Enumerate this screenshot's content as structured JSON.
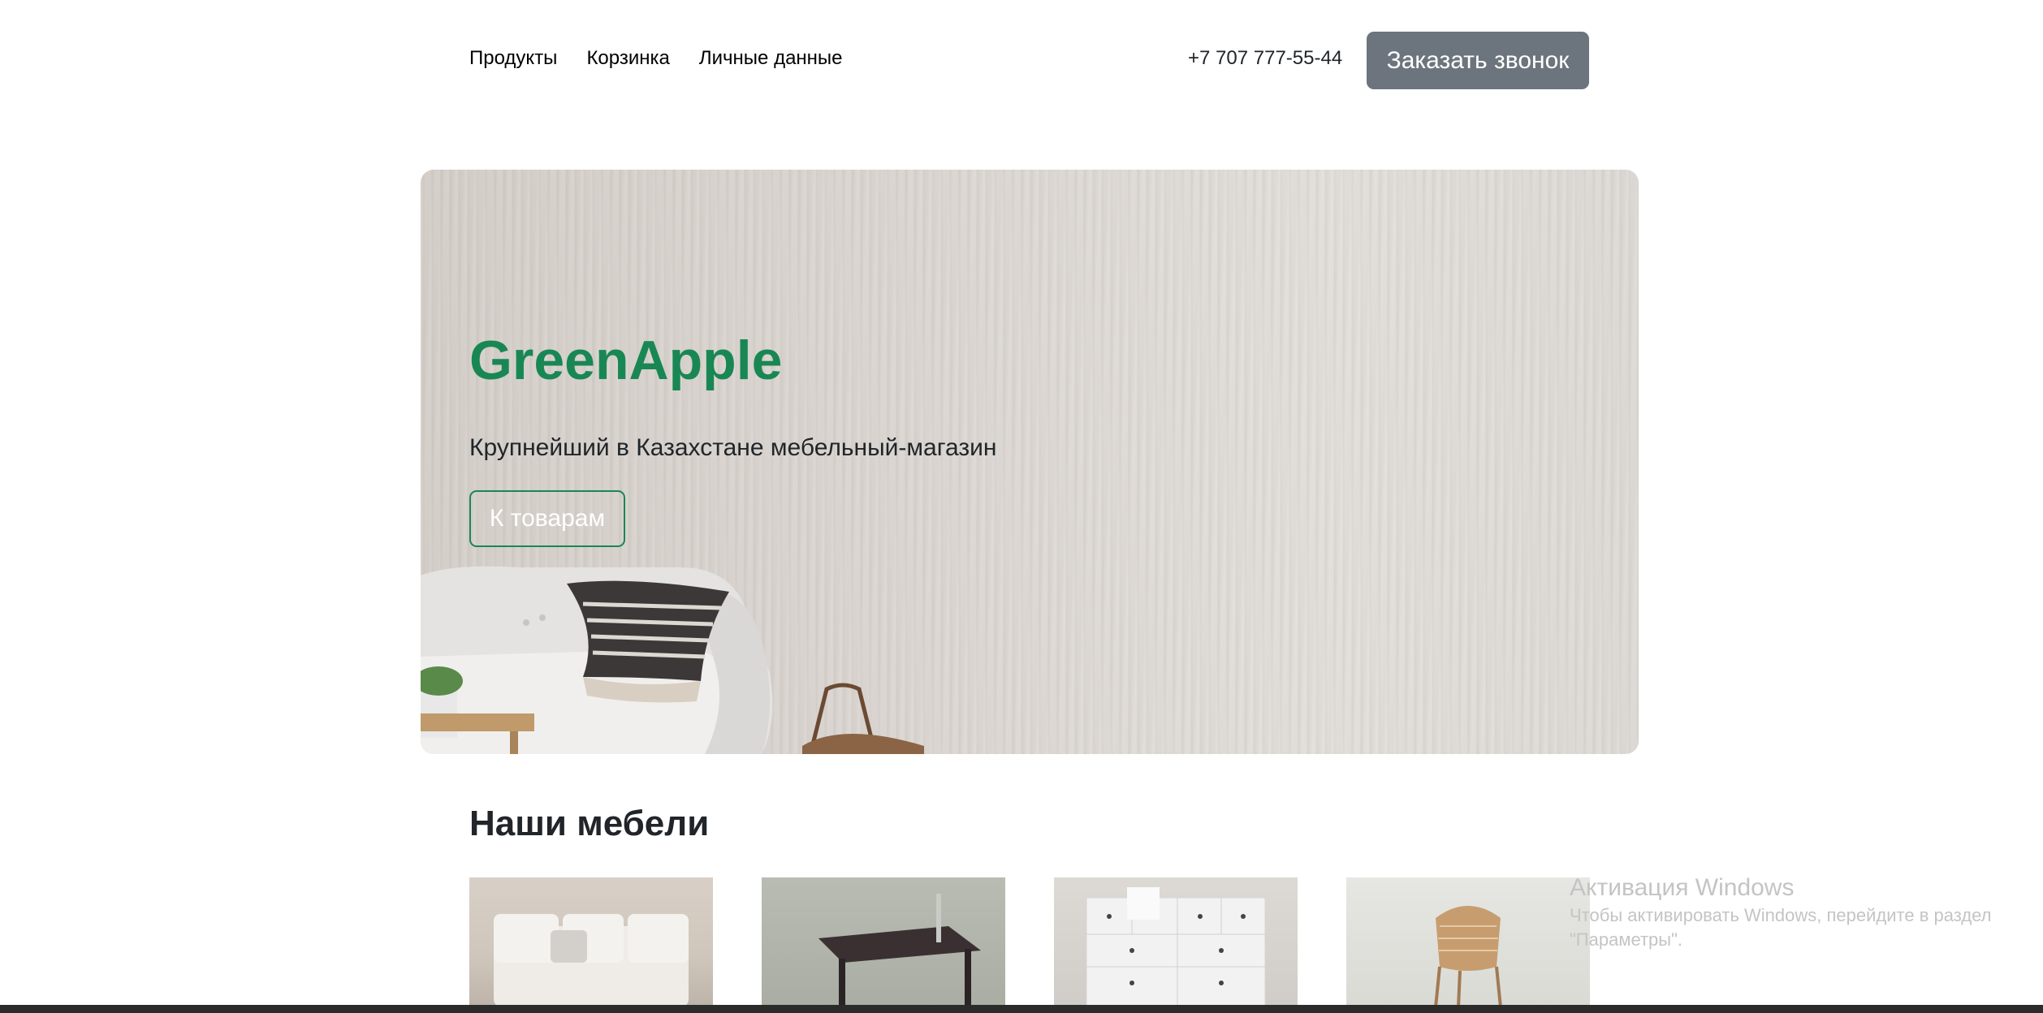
{
  "header": {
    "nav": [
      "Продукты",
      "Корзинка",
      "Личные данные"
    ],
    "phone": "+7 707 777-55-44",
    "call_button": "Заказать звонок"
  },
  "hero": {
    "title": "GreenApple",
    "subtitle": "Крупнейший в Казахстане мебельный-магазин",
    "button": "К товарам"
  },
  "section": {
    "title": "Наши мебели",
    "products": [
      "sofa-image",
      "table-image",
      "dresser-image",
      "chair-image"
    ]
  },
  "watermark": {
    "title": "Активация Windows",
    "text": "Чтобы активировать Windows, перейдите в раздел \"Параметры\"."
  },
  "colors": {
    "brand_green": "#198754",
    "call_button_bg": "#6c757d"
  }
}
